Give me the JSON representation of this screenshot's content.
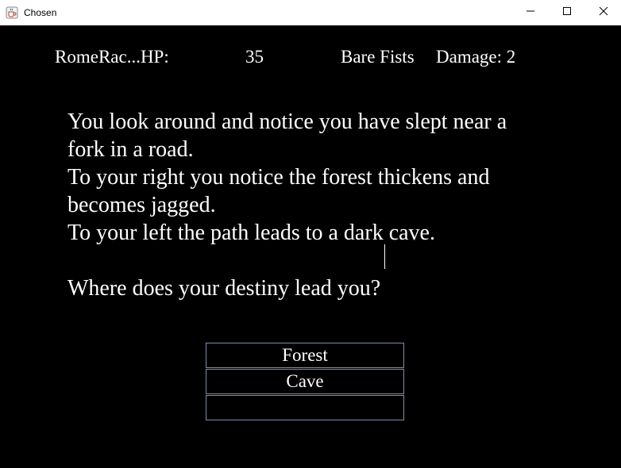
{
  "window": {
    "title": "Chosen",
    "icons": {
      "app": "java-coffee-cup-icon",
      "minimize": "minimize-icon",
      "maximize": "maximize-icon",
      "close": "close-icon"
    }
  },
  "stats": {
    "player": "RomeRac...HP:",
    "hp": "35",
    "weapon": "Bare Fists",
    "damage": "Damage: 2"
  },
  "story": {
    "text": "You look around and notice you have slept near a\nfork in a road.\nTo your right you notice the forest thickens and\nbecomes jagged.\nTo your left the path leads to a dark cave.\n\nWhere does your destiny lead you?"
  },
  "choices": [
    {
      "label": "Forest"
    },
    {
      "label": "Cave"
    },
    {
      "label": ""
    }
  ],
  "colors": {
    "background": "#000000",
    "text": "#ffffff",
    "button_border": "#7f8ea6",
    "titlebar": "#ffffff"
  }
}
